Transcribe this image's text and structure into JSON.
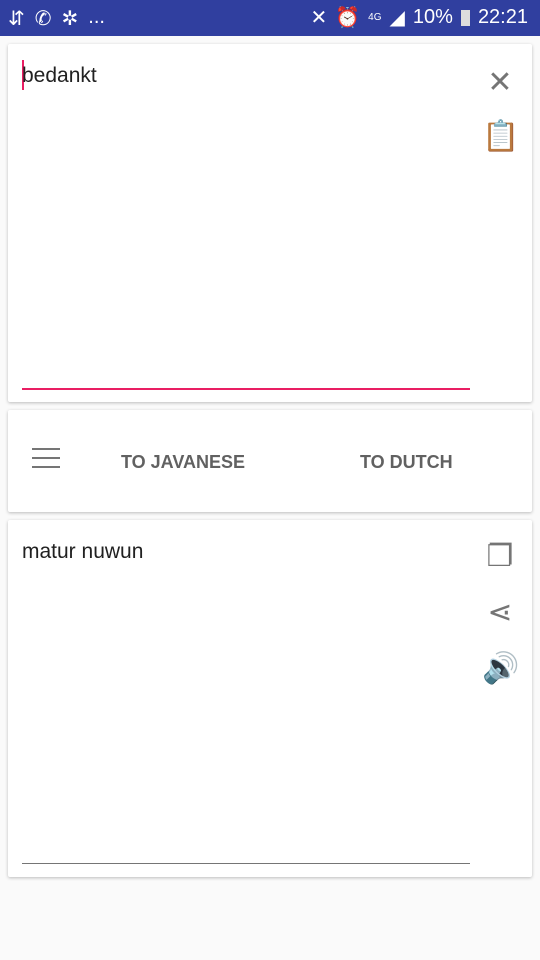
{
  "status_bar": {
    "left_icons": [
      "download-icon",
      "whatsapp-icon",
      "aperture-icon"
    ],
    "more": "...",
    "network": "4G",
    "battery": "10%",
    "time": "22:21"
  },
  "input": {
    "value": "bedankt",
    "clear_icon": "close-icon",
    "paste_icon": "clipboard-icon",
    "underline_color": "#e91e63"
  },
  "toolbar": {
    "menu_icon": "menu-icon",
    "to_javanese": "TO JAVANESE",
    "to_dutch": "TO DUTCH"
  },
  "output": {
    "value": "matur nuwun",
    "copy_icon": "copy-icon",
    "share_icon": "share-icon",
    "speak_icon": "speaker-icon"
  }
}
